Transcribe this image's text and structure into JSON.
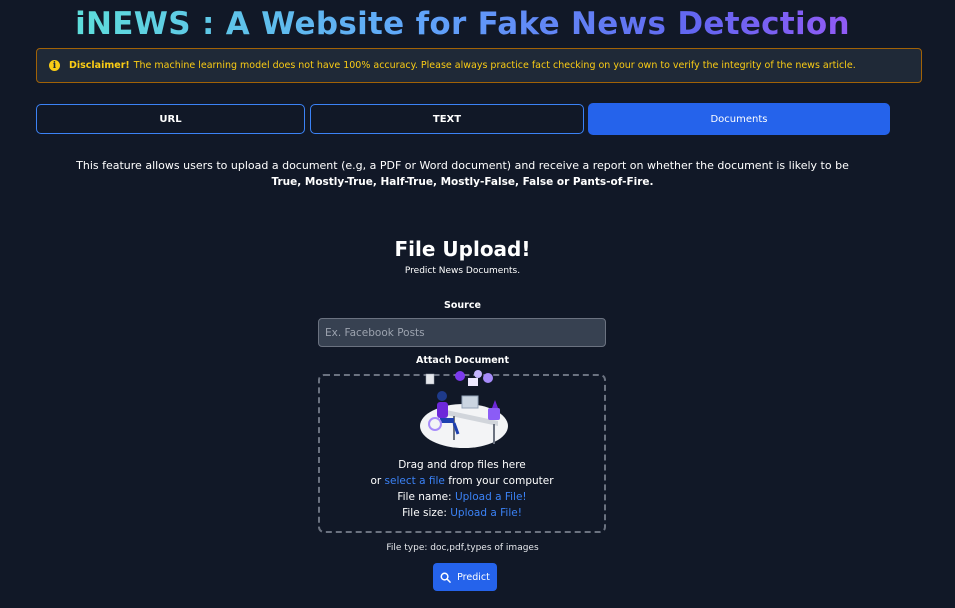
{
  "header": {
    "title": "iNEWS : A Website for Fake News Detection"
  },
  "disclaimer": {
    "icon": "info-circle-icon",
    "label": "Disclaimer!",
    "text": "The machine learning model does not have 100% accuracy. Please always practice fact checking on your own to verify the integrity of the news article."
  },
  "tabs": [
    {
      "label": "URL",
      "active": false
    },
    {
      "label": "TEXT",
      "active": false
    },
    {
      "label": "Documents",
      "active": true
    }
  ],
  "feature": {
    "line1": "This feature allows users to upload a document (e.g, a PDF or Word document) and receive a report on whether the document is likely to be",
    "line2": "True, Mostly-True, Half-True, Mostly-False, False or Pants-of-Fire."
  },
  "upload": {
    "title": "File Upload!",
    "subtitle": "Predict News Documents.",
    "source_label": "Source",
    "source_value": "",
    "source_placeholder": "Ex. Facebook Posts",
    "attach_label": "Attach Document",
    "drag_text": "Drag and drop files here",
    "or_text": "or",
    "select_link": "select a file",
    "from_text": "from your computer",
    "file_name_label": "File name:",
    "file_name_value": "Upload a File!",
    "file_size_label": "File size:",
    "file_size_value": "Upload a File!",
    "file_type_text": "File type: doc,pdf,types of images",
    "predict_label": "Predict",
    "predict_icon": "search-icon"
  },
  "colors": {
    "background": "#111827",
    "accent": "#2563eb",
    "warning": "#facc15",
    "link": "#3b82f6"
  }
}
